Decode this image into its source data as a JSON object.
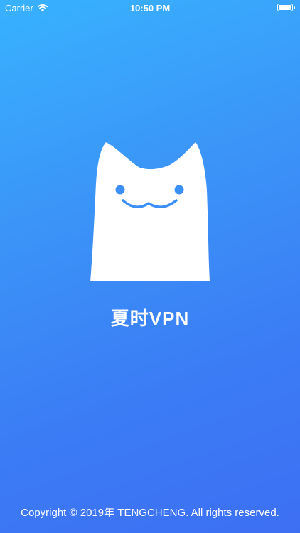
{
  "status_bar": {
    "carrier": "Carrier",
    "wifi_icon": "wifi-icon",
    "time": "10:50 PM",
    "battery_icon": "battery-icon",
    "battery_level": 1.0
  },
  "splash": {
    "logo_icon": "cat-face-icon",
    "app_name": "夏时VPN",
    "copyright": "Copyright © 2019年 TENGCHENG. All rights reserved."
  },
  "colors": {
    "gradient_top": "#38b2ff",
    "gradient_bottom": "#3d6ff3",
    "logo": "#ffffff",
    "logo_features": "#3b8ff7"
  }
}
